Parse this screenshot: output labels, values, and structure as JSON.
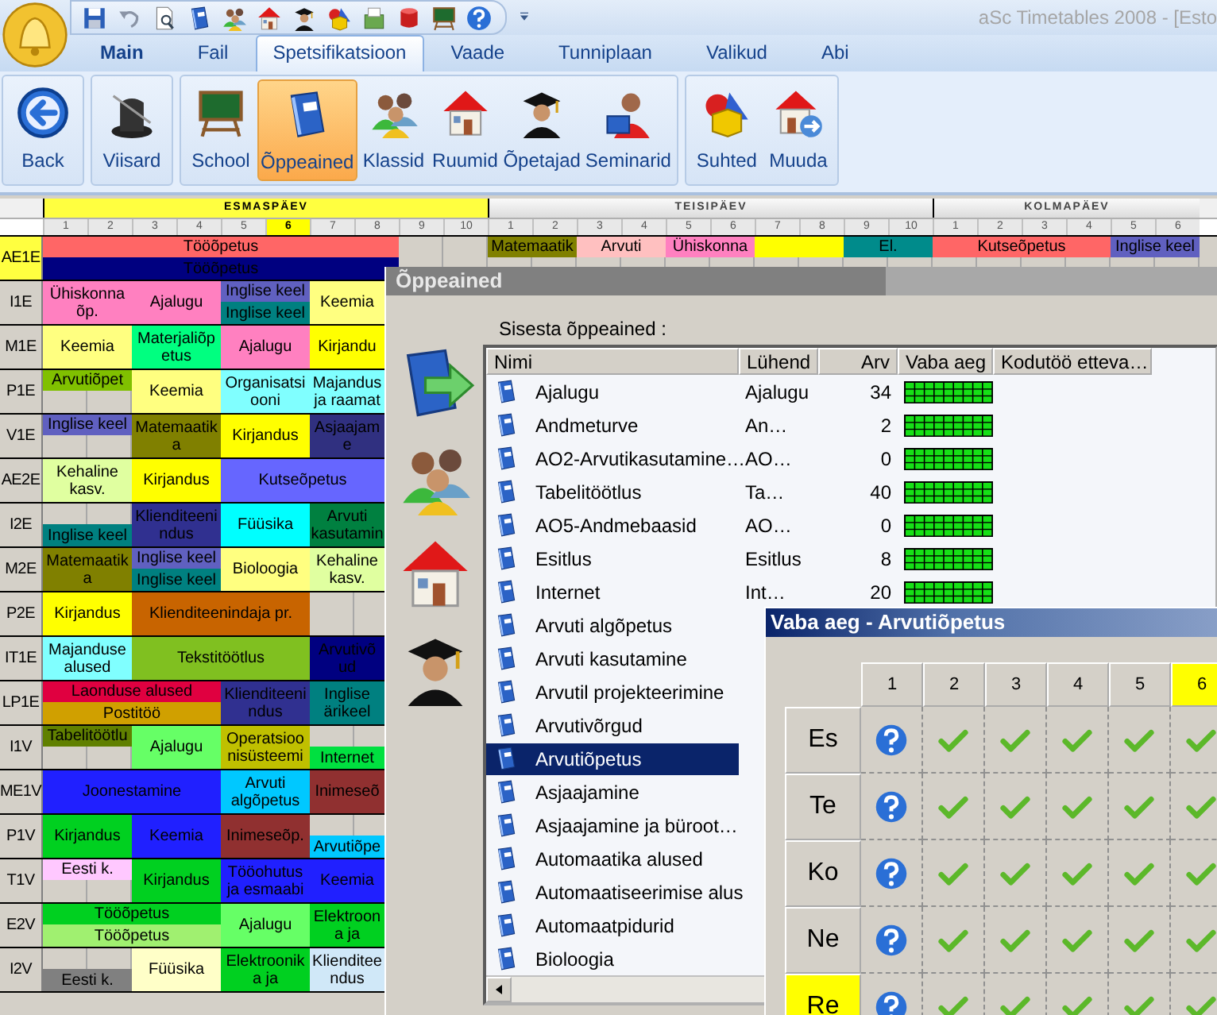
{
  "app": {
    "title": "aSc Timetables 2008  - [Esto"
  },
  "tabs": [
    {
      "label": "Main",
      "selected": false
    },
    {
      "label": "Fail",
      "selected": false
    },
    {
      "label": "Spetsifikatsioon",
      "selected": true
    },
    {
      "label": "Vaade",
      "selected": false
    },
    {
      "label": "Tunniplaan",
      "selected": false
    },
    {
      "label": "Valikud",
      "selected": false
    },
    {
      "label": "Abi",
      "selected": false
    }
  ],
  "ribbon": {
    "groups": [
      {
        "buttons": [
          {
            "label": "Back",
            "selected": false
          }
        ]
      },
      {
        "buttons": [
          {
            "label": "Viisard",
            "selected": false
          }
        ]
      },
      {
        "buttons": [
          {
            "label": "School",
            "selected": false
          },
          {
            "label": "Õppeained",
            "selected": true
          },
          {
            "label": "Klassid",
            "selected": false
          },
          {
            "label": "Ruumid",
            "selected": false
          },
          {
            "label": "Õpetajad",
            "selected": false
          },
          {
            "label": "Seminarid",
            "selected": false
          }
        ]
      },
      {
        "buttons": [
          {
            "label": "Suhted",
            "selected": false
          },
          {
            "label": "Muuda",
            "selected": false
          }
        ]
      }
    ]
  },
  "timetable": {
    "days": [
      {
        "name": "ESMASPÄEV",
        "selected": true,
        "periods": [
          {
            "label": "1",
            "selected": false
          },
          {
            "label": "2",
            "selected": false
          },
          {
            "label": "3",
            "selected": false
          },
          {
            "label": "4",
            "selected": false
          },
          {
            "label": "5",
            "selected": false
          },
          {
            "label": "6",
            "selected": true
          },
          {
            "label": "7",
            "selected": false
          },
          {
            "label": "8",
            "selected": false
          },
          {
            "label": "9",
            "selected": false
          },
          {
            "label": "10",
            "selected": false
          }
        ]
      },
      {
        "name": "TEISIPÄEV",
        "selected": false,
        "periods": [
          {
            "label": "1",
            "selected": false
          },
          {
            "label": "2",
            "selected": false
          },
          {
            "label": "3",
            "selected": false
          },
          {
            "label": "4",
            "selected": false
          },
          {
            "label": "5",
            "selected": false
          },
          {
            "label": "6",
            "selected": false
          },
          {
            "label": "7",
            "selected": false
          },
          {
            "label": "8",
            "selected": false
          },
          {
            "label": "9",
            "selected": false
          },
          {
            "label": "10",
            "selected": false
          }
        ]
      },
      {
        "name": "KOLMAPÄEV",
        "selected": false,
        "periods": [
          {
            "label": "1",
            "selected": false
          },
          {
            "label": "2",
            "selected": false
          },
          {
            "label": "3",
            "selected": false
          },
          {
            "label": "4",
            "selected": false
          },
          {
            "label": "5",
            "selected": false
          },
          {
            "label": "6",
            "selected": false
          }
        ]
      }
    ],
    "rows": [
      {
        "class": "AE1E",
        "selected": true,
        "days": [
          {
            "blocks": [
              {
                "kind": "octet",
                "lessons": [
                  {
                    "text": "Tööõpetus",
                    "color": "#ff6666",
                    "kind": "upper"
                  },
                  {
                    "text": "Tööõpetus",
                    "color": "#000080",
                    "kind": "lower"
                  }
                ]
              }
            ]
          },
          {
            "blocks": [
              {
                "kind": "double",
                "lessons": [
                  {
                    "text": "Matemaatik",
                    "color": "#808000",
                    "kind": "upper"
                  }
                ]
              },
              {
                "kind": "double",
                "lessons": [
                  {
                    "text": "Arvuti",
                    "color": "#ffc0c0",
                    "kind": "upper"
                  }
                ]
              },
              {
                "kind": "double",
                "lessons": [
                  {
                    "text": "Ühiskonna",
                    "color": "#ff80c0",
                    "kind": "upper"
                  }
                ]
              },
              {
                "kind": "double",
                "lessons": [
                  {
                    "color": "#ffff00",
                    "kind": "upper"
                  }
                ]
              },
              {
                "kind": "double",
                "lessons": [
                  {
                    "text": "El.",
                    "color": "#008b8b",
                    "kind": "upper"
                  }
                ]
              }
            ]
          },
          {
            "blocks": [
              {
                "kind": "quad",
                "lessons": [
                  {
                    "text": "Kutseõpetus",
                    "color": "#ff6666",
                    "kind": "upper"
                  }
                ]
              },
              {
                "kind": "double",
                "lessons": [
                  {
                    "text": "Inglise keel",
                    "color": "#6060c0",
                    "kind": "upper"
                  }
                ]
              }
            ]
          }
        ]
      },
      {
        "class": "I1E",
        "selected": false,
        "days": [
          {
            "blocks": [
              {
                "kind": "double",
                "lessons": [
                  {
                    "text": "Ühiskonna õp.",
                    "color": "#ff80c0",
                    "kind": "whole"
                  }
                ]
              },
              {
                "kind": "double",
                "lessons": [
                  {
                    "text": "Ajalugu",
                    "color": "#ff80c0",
                    "kind": "whole"
                  }
                ]
              },
              {
                "kind": "double",
                "lessons": [
                  {
                    "text": "Inglise keel",
                    "color": "#6060c0",
                    "kind": "upper"
                  },
                  {
                    "text": "Inglise keel",
                    "color": "#008080",
                    "kind": "lower"
                  }
                ]
              },
              {
                "kind": "double",
                "lessons": [
                  {
                    "text": "Keemia",
                    "color": "#ffff80",
                    "kind": "whole"
                  }
                ]
              }
            ]
          }
        ]
      },
      {
        "class": "M1E",
        "selected": false,
        "days": [
          {
            "blocks": [
              {
                "kind": "double",
                "lessons": [
                  {
                    "text": "Keemia",
                    "color": "#ffff80",
                    "kind": "whole"
                  }
                ]
              },
              {
                "kind": "double",
                "lessons": [
                  {
                    "text": "Materjaliõp etus",
                    "color": "#00ff80",
                    "kind": "whole"
                  }
                ]
              },
              {
                "kind": "double",
                "lessons": [
                  {
                    "text": "Ajalugu",
                    "color": "#ff80c0",
                    "kind": "whole"
                  }
                ]
              },
              {
                "kind": "double",
                "lessons": [
                  {
                    "text": "Kirjandu",
                    "color": "#ffff00",
                    "kind": "whole"
                  }
                ]
              }
            ]
          }
        ]
      },
      {
        "class": "P1E",
        "selected": false,
        "days": [
          {
            "blocks": [
              {
                "kind": "double",
                "lessons": [
                  {
                    "text": "Arvutiõpet",
                    "color": "#80c000",
                    "kind": "upper"
                  }
                ]
              },
              {
                "kind": "double",
                "lessons": [
                  {
                    "text": "Keemia",
                    "color": "#ffff80",
                    "kind": "whole"
                  }
                ]
              },
              {
                "kind": "double",
                "lessons": [
                  {
                    "text": "Organisatsi ooni",
                    "color": "#80ffff",
                    "kind": "whole"
                  }
                ]
              },
              {
                "kind": "double",
                "lessons": [
                  {
                    "text": "Majandus ja raamat",
                    "color": "#80ffff",
                    "kind": "whole"
                  }
                ]
              }
            ]
          }
        ]
      },
      {
        "class": "V1E",
        "selected": false,
        "days": [
          {
            "blocks": [
              {
                "kind": "double",
                "lessons": [
                  {
                    "text": "Inglise keel",
                    "color": "#6060c0",
                    "kind": "upper"
                  }
                ]
              },
              {
                "kind": "double",
                "lessons": [
                  {
                    "text": "Matemaatik a",
                    "color": "#808000",
                    "kind": "whole"
                  }
                ]
              },
              {
                "kind": "double",
                "lessons": [
                  {
                    "text": "Kirjandus",
                    "color": "#ffff00",
                    "kind": "whole"
                  }
                ]
              },
              {
                "kind": "double",
                "lessons": [
                  {
                    "text": "Asjaajam e",
                    "color": "#303080",
                    "kind": "whole"
                  }
                ]
              }
            ]
          }
        ]
      },
      {
        "class": "AE2E",
        "selected": false,
        "days": [
          {
            "blocks": [
              {
                "kind": "double",
                "lessons": [
                  {
                    "text": "Kehaline kasv.",
                    "color": "#e0ffa0",
                    "kind": "whole"
                  }
                ]
              },
              {
                "kind": "double",
                "lessons": [
                  {
                    "text": "Kirjandus",
                    "color": "#ffff00",
                    "kind": "whole"
                  }
                ]
              },
              {
                "kind": "quad",
                "lessons": [
                  {
                    "text": "Kutseõpetus",
                    "color": "#6666ff",
                    "kind": "whole"
                  }
                ]
              }
            ]
          }
        ]
      },
      {
        "class": "I2E",
        "selected": false,
        "days": [
          {
            "blocks": [
              {
                "kind": "double",
                "lessons": [
                  {
                    "text": "Inglise keel",
                    "color": "#008080",
                    "kind": "lower"
                  }
                ]
              },
              {
                "kind": "double",
                "lessons": [
                  {
                    "text": "Klienditeeni ndus",
                    "color": "#303090",
                    "kind": "whole"
                  }
                ]
              },
              {
                "kind": "double",
                "lessons": [
                  {
                    "text": "Füüsika",
                    "color": "#00ffff",
                    "kind": "whole"
                  }
                ]
              },
              {
                "kind": "double",
                "lessons": [
                  {
                    "text": "Arvuti kasutamin",
                    "color": "#008040",
                    "kind": "whole"
                  }
                ]
              }
            ]
          }
        ]
      },
      {
        "class": "M2E",
        "selected": false,
        "days": [
          {
            "blocks": [
              {
                "kind": "double",
                "lessons": [
                  {
                    "text": "Matemaatik a",
                    "color": "#808000",
                    "kind": "whole"
                  }
                ]
              },
              {
                "kind": "double",
                "lessons": [
                  {
                    "text": "Inglise keel",
                    "color": "#6060c0",
                    "kind": "upper"
                  },
                  {
                    "text": "Inglise keel",
                    "color": "#008080",
                    "kind": "lower"
                  }
                ]
              },
              {
                "kind": "double",
                "lessons": [
                  {
                    "text": "Bioloogia",
                    "color": "#ffff80",
                    "kind": "whole"
                  }
                ]
              },
              {
                "kind": "double",
                "lessons": [
                  {
                    "text": "Kehaline kasv.",
                    "color": "#e0ffa0",
                    "kind": "whole"
                  }
                ]
              }
            ]
          }
        ]
      },
      {
        "class": "P2E",
        "selected": false,
        "days": [
          {
            "blocks": [
              {
                "kind": "double",
                "lessons": [
                  {
                    "text": "Kirjandus",
                    "color": "#ffff00",
                    "kind": "whole"
                  }
                ]
              },
              {
                "kind": "quad",
                "lessons": [
                  {
                    "text": "Klienditeenindaja pr.",
                    "color": "#c86400",
                    "kind": "whole"
                  }
                ]
              }
            ]
          }
        ]
      },
      {
        "class": "IT1E",
        "selected": false,
        "days": [
          {
            "blocks": [
              {
                "kind": "double",
                "lessons": [
                  {
                    "text": "Majanduse alused",
                    "color": "#80ffff",
                    "kind": "whole"
                  }
                ]
              },
              {
                "kind": "quad",
                "lessons": [
                  {
                    "text": "Tekstitöötlus",
                    "color": "#80c020",
                    "kind": "whole"
                  }
                ]
              },
              {
                "kind": "double",
                "lessons": [
                  {
                    "text": "Arvutivõ ud",
                    "color": "#000080",
                    "kind": "whole"
                  }
                ]
              }
            ]
          }
        ]
      },
      {
        "class": "LP1E",
        "selected": false,
        "days": [
          {
            "blocks": [
              {
                "kind": "quad",
                "lessons": [
                  {
                    "text": "Laonduse alused",
                    "color": "#e00040",
                    "kind": "upper"
                  },
                  {
                    "text": "Postitöö",
                    "color": "#d0a000",
                    "kind": "lower"
                  }
                ]
              },
              {
                "kind": "double",
                "lessons": [
                  {
                    "text": "Klienditeeni ndus",
                    "color": "#303090",
                    "kind": "whole"
                  }
                ]
              },
              {
                "kind": "double",
                "lessons": [
                  {
                    "text": "Inglise ärikeel",
                    "color": "#008080",
                    "kind": "whole"
                  }
                ]
              }
            ]
          }
        ]
      },
      {
        "class": "I1V",
        "selected": false,
        "days": [
          {
            "blocks": [
              {
                "kind": "double",
                "lessons": [
                  {
                    "text": "Tabelitöötlu",
                    "color": "#608000",
                    "kind": "upper"
                  }
                ]
              },
              {
                "kind": "double",
                "lessons": [
                  {
                    "text": "Ajalugu",
                    "color": "#66ff66",
                    "kind": "whole"
                  }
                ]
              },
              {
                "kind": "double",
                "lessons": [
                  {
                    "text": "Operatsioo nisüsteemi",
                    "color": "#c0c000",
                    "kind": "whole"
                  }
                ]
              },
              {
                "kind": "double",
                "lessons": [
                  {
                    "text": "Internet",
                    "color": "#00e040",
                    "kind": "lower"
                  }
                ]
              }
            ]
          }
        ]
      },
      {
        "class": "ME1V",
        "selected": false,
        "days": [
          {
            "blocks": [
              {
                "kind": "quad",
                "lessons": [
                  {
                    "text": "Joonestamine",
                    "color": "#2020ff",
                    "kind": "whole"
                  }
                ]
              },
              {
                "kind": "double",
                "lessons": [
                  {
                    "text": "Arvuti algõpetus",
                    "color": "#00c8ff",
                    "kind": "whole"
                  }
                ]
              },
              {
                "kind": "double",
                "lessons": [
                  {
                    "text": "Inimeseõ",
                    "color": "#903030",
                    "kind": "whole"
                  }
                ]
              }
            ]
          }
        ]
      },
      {
        "class": "P1V",
        "selected": false,
        "days": [
          {
            "blocks": [
              {
                "kind": "double",
                "lessons": [
                  {
                    "text": "Kirjandus",
                    "color": "#00d020",
                    "kind": "whole"
                  }
                ]
              },
              {
                "kind": "double",
                "lessons": [
                  {
                    "text": "Keemia",
                    "color": "#2020ff",
                    "kind": "whole"
                  }
                ]
              },
              {
                "kind": "double",
                "lessons": [
                  {
                    "text": "Inimeseõp.",
                    "color": "#903030",
                    "kind": "whole"
                  }
                ]
              },
              {
                "kind": "double",
                "lessons": [
                  {
                    "text": "Arvutiõpe",
                    "color": "#00c8ff",
                    "kind": "lower"
                  }
                ]
              }
            ]
          }
        ]
      },
      {
        "class": "T1V",
        "selected": false,
        "days": [
          {
            "blocks": [
              {
                "kind": "double",
                "lessons": [
                  {
                    "text": "Eesti k.",
                    "color": "#ffc8ff",
                    "kind": "upper"
                  }
                ]
              },
              {
                "kind": "double",
                "lessons": [
                  {
                    "text": "Kirjandus",
                    "color": "#00d020",
                    "kind": "whole"
                  }
                ]
              },
              {
                "kind": "double",
                "lessons": [
                  {
                    "text": "Tööohutus ja esmaabi",
                    "color": "#2020ff",
                    "kind": "whole"
                  }
                ]
              },
              {
                "kind": "double",
                "lessons": [
                  {
                    "text": "Keemia",
                    "color": "#2020ff",
                    "kind": "whole"
                  }
                ]
              }
            ]
          }
        ]
      },
      {
        "class": "E2V",
        "selected": false,
        "days": [
          {
            "blocks": [
              {
                "kind": "quad",
                "lessons": [
                  {
                    "text": "Tööõpetus",
                    "color": "#00d020",
                    "kind": "upper"
                  },
                  {
                    "text": "Tööõpetus",
                    "color": "#a0f070",
                    "kind": "lower"
                  }
                ]
              },
              {
                "kind": "double",
                "lessons": [
                  {
                    "text": "Ajalugu",
                    "color": "#66ff66",
                    "kind": "whole"
                  }
                ]
              },
              {
                "kind": "double",
                "lessons": [
                  {
                    "text": "Elektroon a ja",
                    "color": "#00d020",
                    "kind": "whole"
                  }
                ]
              }
            ]
          }
        ]
      },
      {
        "class": "I2V",
        "selected": false,
        "days": [
          {
            "blocks": [
              {
                "kind": "double",
                "lessons": [
                  {
                    "text": "Eesti k.",
                    "color": "#808080",
                    "kind": "lower"
                  }
                ]
              },
              {
                "kind": "double",
                "lessons": [
                  {
                    "text": "Füüsika",
                    "color": "#ffffc8",
                    "kind": "whole"
                  }
                ]
              },
              {
                "kind": "double",
                "lessons": [
                  {
                    "text": "Elektroonik a ja",
                    "color": "#00d020",
                    "kind": "whole"
                  }
                ]
              },
              {
                "kind": "double",
                "lessons": [
                  {
                    "text": "Klienditee ndus",
                    "color": "#d0e8f8",
                    "kind": "whole"
                  }
                ]
              }
            ]
          }
        ]
      }
    ]
  },
  "subjects_dialog": {
    "title": "Õppeained",
    "prompt": "Sisesta õppeained :",
    "columns": [
      "Nimi",
      "Lühend",
      "Arv",
      "Vaba aeg",
      "Kodutöö etteva…"
    ],
    "rows": [
      {
        "name": "Ajalugu",
        "short": "Ajalugu",
        "count": "34",
        "selected": false
      },
      {
        "name": "Andmeturve",
        "short": "An…",
        "count": "2",
        "selected": false
      },
      {
        "name": "AO2-Arvutikasutamine…",
        "short": "AO…",
        "count": "0",
        "selected": false
      },
      {
        "name": "Tabelitöötlus",
        "short": "Ta…",
        "count": "40",
        "selected": false
      },
      {
        "name": "AO5-Andmebaasid",
        "short": "AO…",
        "count": "0",
        "selected": false
      },
      {
        "name": "Esitlus",
        "short": "Esitlus",
        "count": "8",
        "selected": false
      },
      {
        "name": "Internet",
        "short": "Int…",
        "count": "20",
        "selected": false
      },
      {
        "name": "Arvuti algõpetus",
        "selected": false
      },
      {
        "name": "Arvuti kasutamine",
        "selected": false
      },
      {
        "name": "Arvutil projekteerimine",
        "selected": false
      },
      {
        "name": "Arvutivõrgud",
        "selected": false
      },
      {
        "name": "Arvutiõpetus",
        "selected": true
      },
      {
        "name": "Asjaajamine",
        "selected": false
      },
      {
        "name": "Asjaajamine ja büroot…",
        "selected": false
      },
      {
        "name": "Automaatika alused",
        "selected": false
      },
      {
        "name": "Automaatiseerimise alus",
        "selected": false
      },
      {
        "name": "Automaatpidurid",
        "selected": false
      },
      {
        "name": "Bioloogia",
        "selected": false
      }
    ]
  },
  "free_time_dialog": {
    "title": "Vaba aeg - Arvutiõpetus",
    "periods": [
      {
        "label": "1",
        "selected": false
      },
      {
        "label": "2",
        "selected": false
      },
      {
        "label": "3",
        "selected": false
      },
      {
        "label": "4",
        "selected": false
      },
      {
        "label": "5",
        "selected": false
      },
      {
        "label": "6",
        "selected": true
      }
    ],
    "days": [
      {
        "label": "Es",
        "selected": false,
        "cells": [
          {
            "kind": "unknown"
          },
          {
            "kind": "free"
          },
          {
            "kind": "free"
          },
          {
            "kind": "free"
          },
          {
            "kind": "free"
          },
          {
            "kind": "free"
          }
        ]
      },
      {
        "label": "Te",
        "selected": false,
        "cells": [
          {
            "kind": "unknown"
          },
          {
            "kind": "free"
          },
          {
            "kind": "free"
          },
          {
            "kind": "free"
          },
          {
            "kind": "free"
          },
          {
            "kind": "free"
          }
        ]
      },
      {
        "label": "Ko",
        "selected": false,
        "cells": [
          {
            "kind": "unknown"
          },
          {
            "kind": "free"
          },
          {
            "kind": "free"
          },
          {
            "kind": "free"
          },
          {
            "kind": "free"
          },
          {
            "kind": "free"
          }
        ]
      },
      {
        "label": "Ne",
        "selected": false,
        "cells": [
          {
            "kind": "unknown"
          },
          {
            "kind": "free"
          },
          {
            "kind": "free"
          },
          {
            "kind": "free"
          },
          {
            "kind": "free"
          },
          {
            "kind": "free"
          }
        ]
      },
      {
        "label": "Re",
        "selected": true,
        "cells": [
          {
            "kind": "unknown"
          },
          {
            "kind": "free"
          },
          {
            "kind": "free"
          },
          {
            "kind": "free"
          },
          {
            "kind": "free"
          },
          {
            "kind": "free"
          }
        ]
      }
    ]
  }
}
